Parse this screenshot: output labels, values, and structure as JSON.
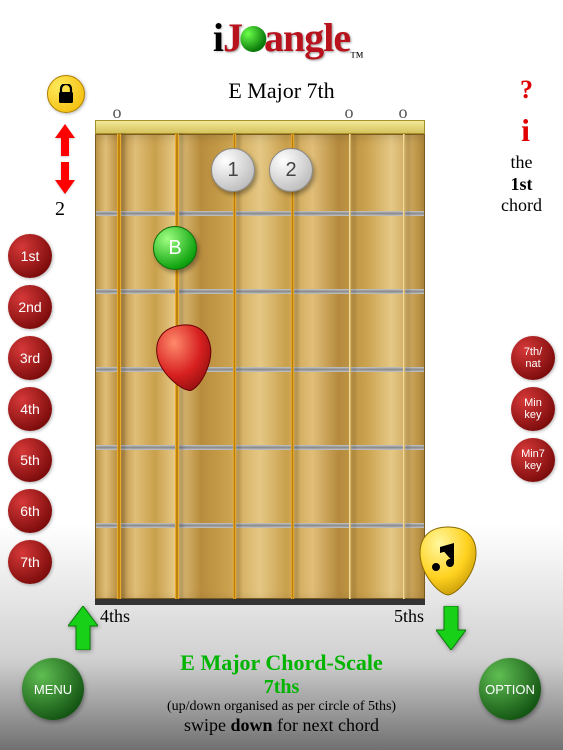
{
  "logo": {
    "pre": "i",
    "mid": "angle",
    "post": "J",
    "tm": "™"
  },
  "chord_title": "E Major 7th",
  "fret_indicator": "2",
  "ordinal": {
    "the": "the",
    "num": "1st",
    "chord": "chord"
  },
  "help_symbol": "?",
  "info_symbol": "i",
  "degree_buttons": [
    "1st",
    "2nd",
    "3rd",
    "4th",
    "5th",
    "6th",
    "7th"
  ],
  "mode_buttons": [
    "7th/\nnat",
    "Min\nkey",
    "Min7\nkey"
  ],
  "open_markers": [
    {
      "string": 0,
      "label": "o"
    },
    {
      "string": 4,
      "label": "o"
    },
    {
      "string": 5,
      "label": "o"
    }
  ],
  "fingers": [
    {
      "string": 2,
      "fret": 1,
      "label": "1",
      "style": "grey"
    },
    {
      "string": 3,
      "fret": 1,
      "label": "2",
      "style": "grey"
    },
    {
      "string": 1,
      "fret": 2,
      "label": "B",
      "style": "green"
    }
  ],
  "direction_labels": {
    "left": "4ths",
    "right": "5ths"
  },
  "bottom_buttons": {
    "menu": "MENU",
    "option": "OPTION"
  },
  "footer": {
    "title": "E Major Chord-Scale",
    "subtitle": "7ths",
    "note": "(up/down organised as per circle of 5ths)",
    "hint_pre": "swipe ",
    "hint_bold": "down",
    "hint_post": " for next chord"
  },
  "chart_data": {
    "type": "table",
    "instrument": "guitar",
    "chord": "E Major 7th",
    "tuning_strings": 6,
    "notes": [
      {
        "string": 6,
        "fret": 0,
        "marker": "open"
      },
      {
        "string": 5,
        "fret": 2,
        "finger": "B",
        "root": true
      },
      {
        "string": 4,
        "fret": 1,
        "finger": 1
      },
      {
        "string": 3,
        "fret": 1,
        "finger": 2
      },
      {
        "string": 2,
        "fret": 0,
        "marker": "open"
      },
      {
        "string": 1,
        "fret": 0,
        "marker": "open"
      }
    ],
    "visible_fret_range": [
      1,
      6
    ]
  }
}
